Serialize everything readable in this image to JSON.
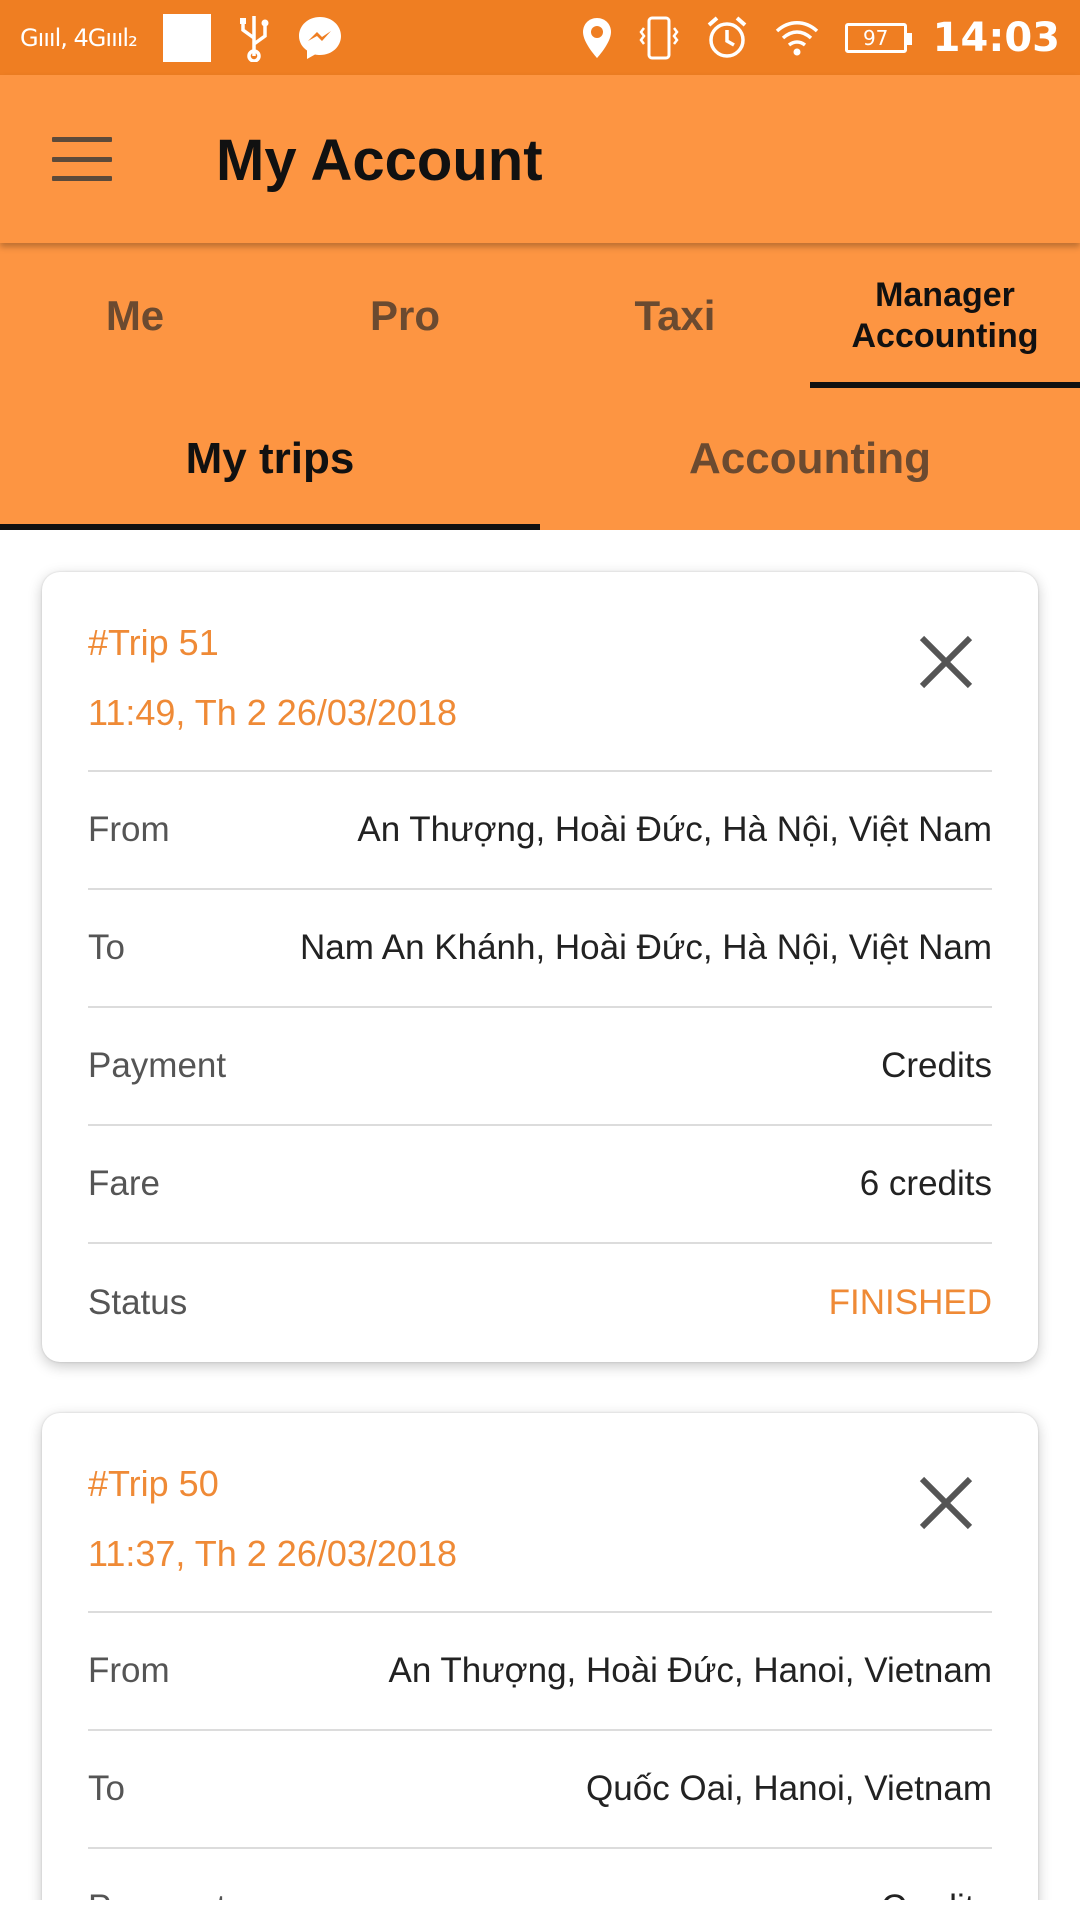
{
  "status_bar": {
    "signal_text": "Gₐ↑↑↑, 4G↑↑↑₂",
    "battery": "97",
    "time": "14:03"
  },
  "app_bar": {
    "title": "My Account"
  },
  "primary_tabs": [
    {
      "label": "Me"
    },
    {
      "label": "Pro"
    },
    {
      "label": "Taxi"
    },
    {
      "label_line1": "Manager",
      "label_line2": "Accounting",
      "active": true
    }
  ],
  "secondary_tabs": [
    {
      "label": "My trips",
      "active": true
    },
    {
      "label": "Accounting"
    }
  ],
  "trips": [
    {
      "id": "#Trip 51",
      "datetime": "11:49, Th 2 26/03/2018",
      "rows": [
        {
          "label": "From",
          "value": "An Thượng, Hoài Đức, Hà Nội, Việt Nam"
        },
        {
          "label": "To",
          "value": "Nam An Khánh, Hoài Đức, Hà Nội, Việt Nam"
        },
        {
          "label": "Payment",
          "value": "Credits"
        },
        {
          "label": "Fare",
          "value": "6 credits"
        },
        {
          "label": "Status",
          "value": "FINISHED"
        }
      ]
    },
    {
      "id": "#Trip 50",
      "datetime": "11:37, Th 2 26/03/2018",
      "rows": [
        {
          "label": "From",
          "value": "An Thượng, Hoài Đức, Hanoi, Vietnam"
        },
        {
          "label": "To",
          "value": "Quốc Oai, Hanoi, Vietnam"
        },
        {
          "label": "Payment",
          "value": "Credits"
        }
      ]
    }
  ],
  "colors": {
    "status_bar": "#ef7e22",
    "app_bar": "#fd9542",
    "accent_text": "#ef8a36"
  }
}
